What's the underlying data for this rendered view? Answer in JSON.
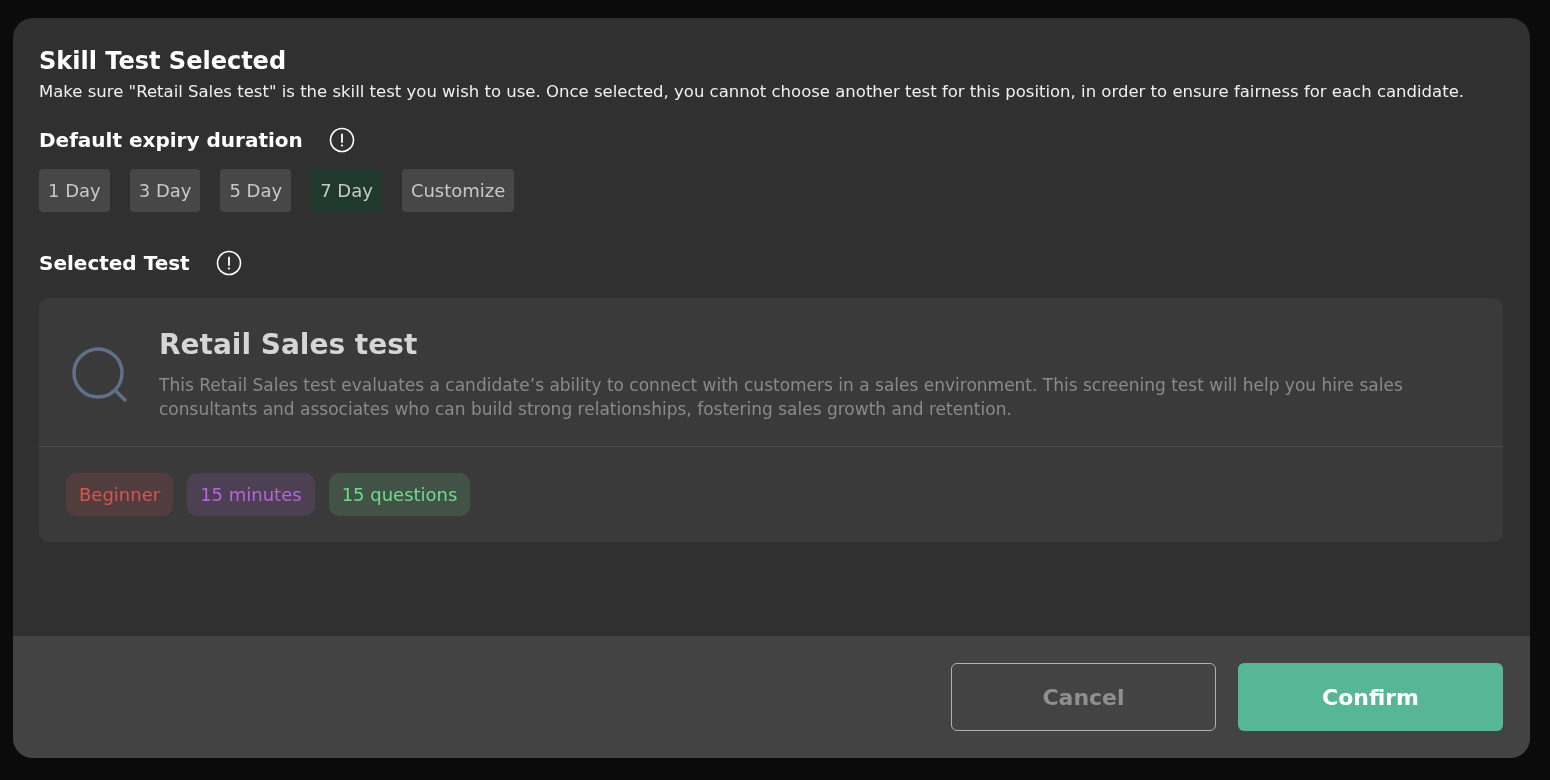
{
  "dialog": {
    "title": "Skill Test Selected",
    "description": "Make sure \"Retail Sales test\" is the skill test you wish to use. Once selected, you cannot choose another test for this position, in order to ensure fairness for each candidate.",
    "expiry": {
      "label": "Default expiry duration",
      "options": [
        {
          "label": "1 Day",
          "selected": false
        },
        {
          "label": "3 Day",
          "selected": false
        },
        {
          "label": "5 Day",
          "selected": false
        },
        {
          "label": "7 Day",
          "selected": true
        },
        {
          "label": "Customize",
          "selected": false
        }
      ]
    },
    "selected_test": {
      "label": "Selected Test",
      "name": "Retail Sales test",
      "description": "This Retail Sales test evaluates a candidate’s ability to connect with customers in a sales environment. This screening test will help you hire sales consultants and associates who can build strong relationships, fostering sales growth and retention.",
      "tags": [
        {
          "label": "Beginner",
          "color": "#d9534f"
        },
        {
          "label": "15 minutes",
          "color": "#b565e0"
        },
        {
          "label": "15 questions",
          "color": "#6fdc8c"
        }
      ]
    },
    "buttons": [
      {
        "label": "Cancel",
        "kind": "secondary"
      },
      {
        "label": "Confirm",
        "kind": "primary"
      }
    ]
  }
}
